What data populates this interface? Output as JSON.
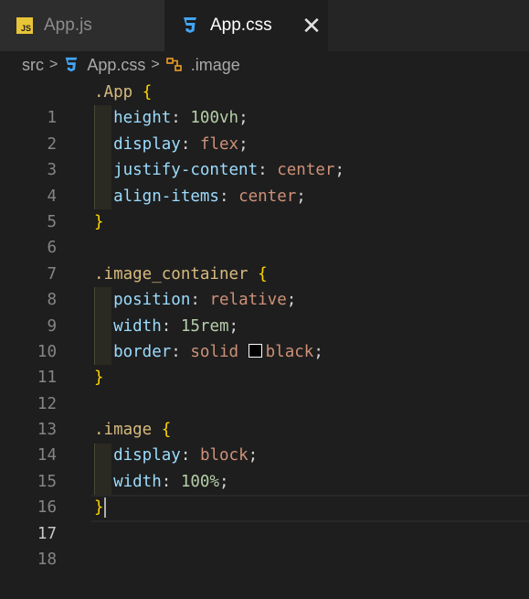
{
  "tabs": [
    {
      "label": "App.js",
      "icon": "js-file-icon",
      "badge": "JS",
      "active": false
    },
    {
      "label": "App.css",
      "icon": "css-file-icon",
      "active": true,
      "close": "✕"
    }
  ],
  "breadcrumb": {
    "folder": "src",
    "file": "App.css",
    "symbol": ".image",
    "separator": ">"
  },
  "editor": {
    "active_line": 17,
    "line_numbers": [
      "1",
      "2",
      "3",
      "4",
      "5",
      "6",
      "7",
      "8",
      "9",
      "10",
      "11",
      "12",
      "13",
      "14",
      "15",
      "16",
      "17",
      "18"
    ],
    "code": {
      "l1_sel": ".App",
      "l1_brace": "{",
      "l2_prop": "height",
      "l2_val": "100vh",
      "l3_prop": "display",
      "l3_val": "flex",
      "l4_prop": "justify-content",
      "l4_val": "center",
      "l5_prop": "align-items",
      "l5_val": "center",
      "l6_brace": "}",
      "l8_sel": ".image_container",
      "l8_brace": "{",
      "l9_prop": "position",
      "l9_val": "relative",
      "l10_prop": "width",
      "l10_val": "15rem",
      "l11_prop": "border",
      "l11_val1": "solid",
      "l11_val2": "black",
      "l12_brace": "}",
      "l14_sel": ".image",
      "l14_brace": "{",
      "l15_prop": "display",
      "l15_val": "block",
      "l16_prop": "width",
      "l16_val": "100%",
      "l17_brace": "}",
      "colon": ":",
      "semi": ";"
    }
  },
  "colors": {
    "background": "#1e1e1e",
    "selector": "#d7ba7d",
    "property": "#9cdcfe",
    "value": "#ce9178",
    "number": "#b5cea8",
    "brace": "#ffd700"
  }
}
